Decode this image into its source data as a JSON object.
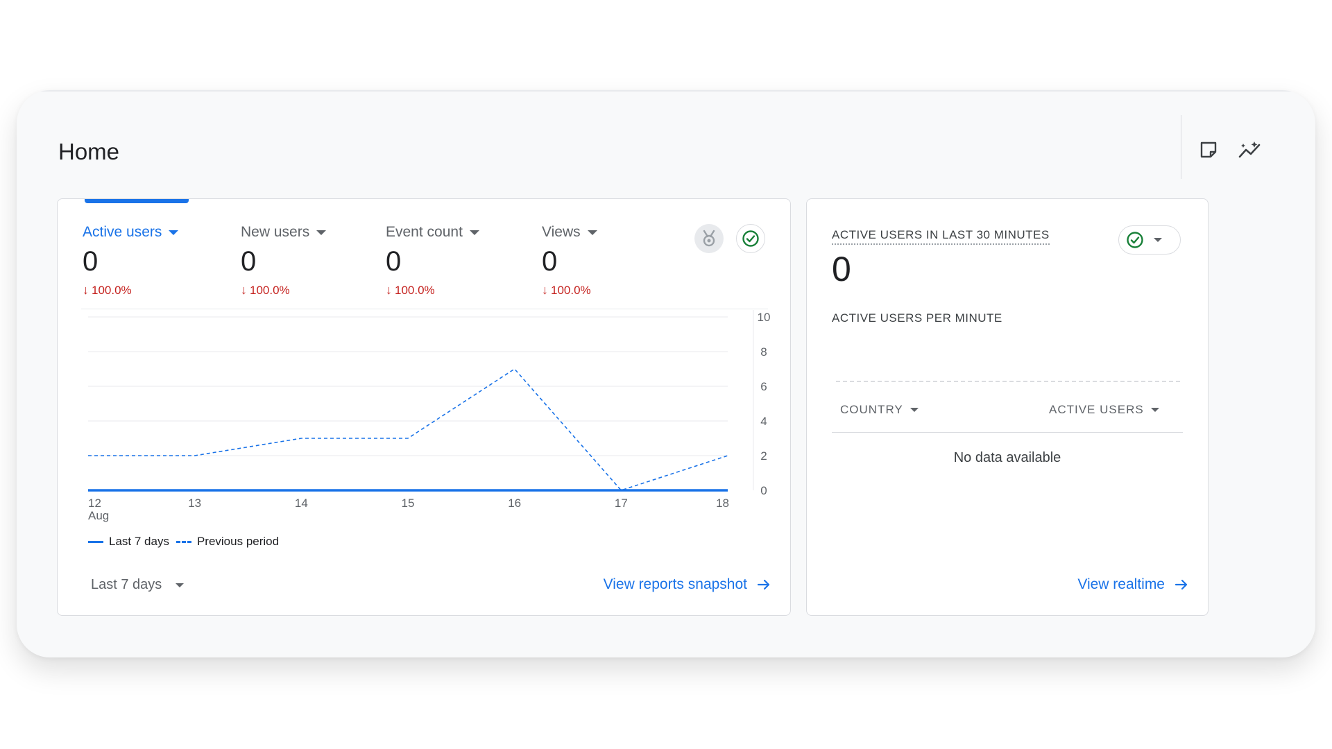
{
  "header": {
    "title": "Home"
  },
  "metrics": [
    {
      "label": "Active users",
      "value": "0",
      "change": "100.0%",
      "active": true
    },
    {
      "label": "New users",
      "value": "0",
      "change": "100.0%",
      "active": false
    },
    {
      "label": "Event count",
      "value": "0",
      "change": "100.0%",
      "active": false
    },
    {
      "label": "Views",
      "value": "0",
      "change": "100.0%",
      "active": false
    }
  ],
  "chart_data": {
    "type": "line",
    "x": [
      "12",
      "13",
      "14",
      "15",
      "16",
      "17",
      "18"
    ],
    "x_sublabel": "Aug",
    "ylim": [
      0,
      10
    ],
    "yticks": [
      "0",
      "2",
      "4",
      "6",
      "8",
      "10"
    ],
    "grid": true,
    "legend_position": "bottom-left",
    "series": [
      {
        "name": "Last 7 days",
        "style": "solid",
        "color": "#1a73e8",
        "values": [
          0,
          0,
          0,
          0,
          0,
          0,
          0
        ]
      },
      {
        "name": "Previous period",
        "style": "dashed",
        "color": "#1a73e8",
        "values": [
          2,
          2,
          3,
          3,
          7,
          0,
          2
        ]
      }
    ]
  },
  "date_range": {
    "label": "Last 7 days"
  },
  "links": {
    "snapshot": "View reports snapshot",
    "realtime": "View realtime"
  },
  "realtime": {
    "title": "ACTIVE USERS IN LAST 30 MINUTES",
    "value": "0",
    "subtitle": "ACTIVE USERS PER MINUTE",
    "columns": [
      "COUNTRY",
      "ACTIVE USERS"
    ],
    "empty_text": "No data available"
  },
  "colors": {
    "accent": "#1a73e8",
    "negative": "#c5221f",
    "positive": "#188038"
  },
  "icons": [
    "note-icon",
    "insights-icon",
    "medal-icon",
    "check-circle-icon",
    "arrow-right-icon",
    "arrow-down-icon",
    "caret-down-icon"
  ]
}
